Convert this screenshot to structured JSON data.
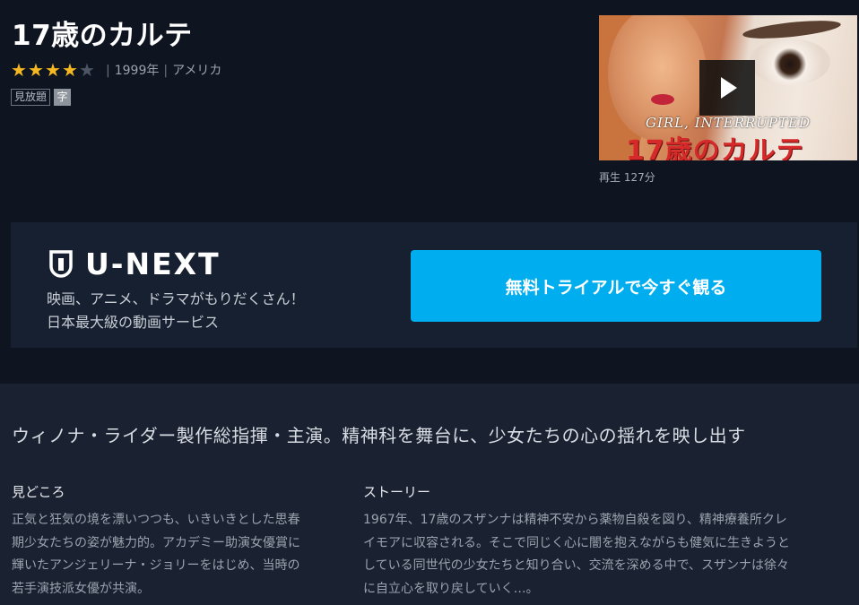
{
  "title": "17歳のカルテ",
  "rating": {
    "score": 4,
    "max": 5
  },
  "meta": {
    "year": "1999年",
    "country": "アメリカ"
  },
  "badges": {
    "unlimited": "見放題",
    "subtitle": "字"
  },
  "thumbnail": {
    "english_title": "GIRL, INTERRUPTED",
    "japanese_title": "17歳のカルテ",
    "play_icon": "play-icon"
  },
  "playback": {
    "label": "再生",
    "duration": "127分"
  },
  "banner": {
    "logo_text": "U-NEXT",
    "line1": "映画、アニメ、ドラマがもりだくさん！",
    "line2": "日本最大級の動画サービス",
    "cta_label": "無料トライアルで今すぐ観る",
    "cta_color": "#00aef0"
  },
  "headline": "ウィノナ・ライダー製作総指揮・主演。精神科を舞台に、少女たちの心の揺れを映し出す",
  "highlights": {
    "heading": "見どころ",
    "lines": [
      "正気と狂気の境を漂いつつも、いきいきとした思春",
      "期少女たちの姿が魅力的。アカデミー助演女優賞に",
      "輝いたアンジェリーナ・ジョリーをはじめ、当時の",
      "若手演技派女優が共演。"
    ]
  },
  "story": {
    "heading": "ストーリー",
    "lines": [
      "1967年、17歳のスザンナは精神不安から薬物自殺を図り、精神療養所クレ",
      "イモアに収容される。そこで同じく心に闇を抱えながらも健気に生きようと",
      "している同世代の少女たちと知り合い、交流を深める中で、スザンナは徐々",
      "に自立心を取り戻していく…。"
    ]
  }
}
